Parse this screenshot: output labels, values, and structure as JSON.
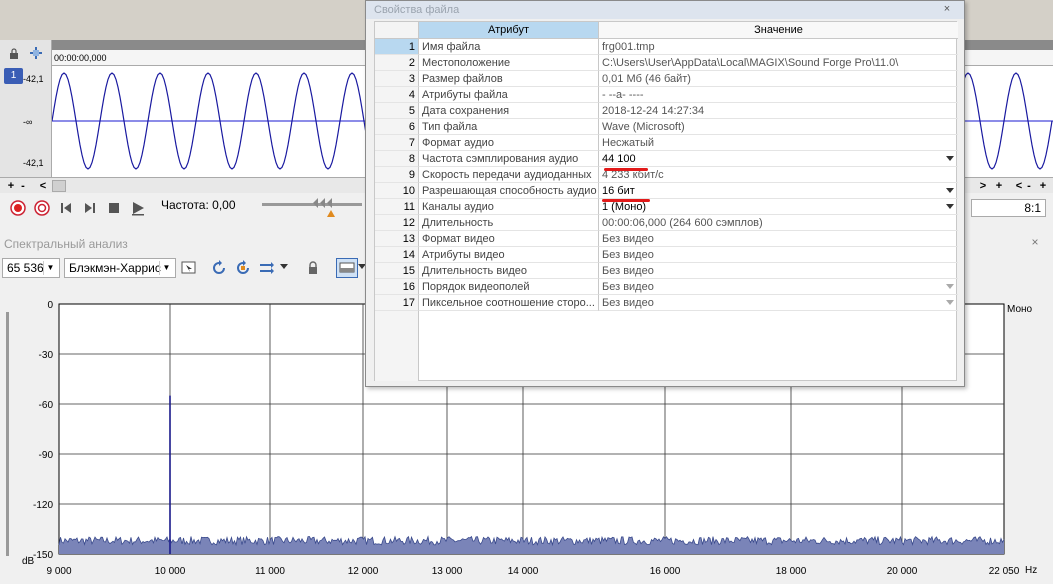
{
  "waveform": {
    "track_number": "1",
    "db_top": "-42,1",
    "db_mid": "-∞",
    "db_bottom": "-42,1",
    "start_time": "00:00:00,000",
    "zoom_ratio": "8:1",
    "scroll_plus": "+",
    "scroll_minus": "-",
    "scroll_left": "<",
    "scroll_right": ">"
  },
  "transport": {
    "frequency_label": "Частота: 0,00"
  },
  "spectrum": {
    "title": "Спектральный анализ",
    "close_glyph": "×",
    "fft_size": "65 536",
    "window": "Блэкмэн-Харрис",
    "channel_label": "Моно",
    "unit_db": "dB",
    "unit_hz": "Hz"
  },
  "dialog": {
    "title": "Свойства файла",
    "close_glyph": "×",
    "header_attr": "Атрибут",
    "header_value": "Значение",
    "rows": [
      {
        "num": "1",
        "attr": "Имя файла",
        "value": "frg001.tmp"
      },
      {
        "num": "2",
        "attr": "Местоположение",
        "value": "C:\\Users\\User\\AppData\\Local\\MAGIX\\Sound Forge Pro\\11.0\\"
      },
      {
        "num": "3",
        "attr": "Размер файлов",
        "value": "0,01 Мб (46 байт)"
      },
      {
        "num": "4",
        "attr": "Атрибуты файла",
        "value": "- --a- ----"
      },
      {
        "num": "5",
        "attr": "Дата сохранения",
        "value": "2018-12-24   14:27:34"
      },
      {
        "num": "6",
        "attr": "Тип файла",
        "value": "Wave (Microsoft)"
      },
      {
        "num": "7",
        "attr": "Формат аудио",
        "value": "Несжатый"
      },
      {
        "num": "8",
        "attr": "Частота сэмплирования аудио",
        "value": "44 100"
      },
      {
        "num": "9",
        "attr": "Скорость передачи аудиоданных",
        "value": "4 233 кбит/с"
      },
      {
        "num": "10",
        "attr": "Разрешающая способность аудио",
        "value": "16 бит"
      },
      {
        "num": "11",
        "attr": "Каналы аудио",
        "value": "1  (Моно)"
      },
      {
        "num": "12",
        "attr": "Длительность",
        "value": "00:00:06,000 (264 600 сэмплов)"
      },
      {
        "num": "13",
        "attr": "Формат видео",
        "value": "Без видео"
      },
      {
        "num": "14",
        "attr": "Атрибуты видео",
        "value": "Без видео"
      },
      {
        "num": "15",
        "attr": "Длительность видео",
        "value": "Без видео"
      },
      {
        "num": "16",
        "attr": "Порядок видеополей",
        "value": "Без видео"
      },
      {
        "num": "17",
        "attr": "Пиксельное соотношение сторо...",
        "value": "Без видео"
      }
    ]
  },
  "chart_data": {
    "type": "area",
    "xlabel": "Hz",
    "ylabel": "dB",
    "xlim": [
      9000,
      22050
    ],
    "ylim": [
      -150,
      0
    ],
    "x_ticks": [
      "9 000",
      "10 000",
      "11 000",
      "12 000",
      "13 000",
      "14 000",
      "16 000",
      "18 000",
      "20 000",
      "22 050"
    ],
    "y_ticks": [
      "0",
      "-30",
      "-60",
      "-90",
      "-120",
      "-150"
    ],
    "grid": true,
    "noise_floor_db": -142,
    "peak": {
      "x": 10000,
      "y": -55
    },
    "series_color": "#3a4a8c",
    "fill_color": "#7a84b8"
  },
  "colors": {
    "wave_line": "#1a1aa0",
    "center_line": "#1a1ad0",
    "highlight_red": "#e21a1a",
    "selected_row_num": "#b8d8f0"
  }
}
